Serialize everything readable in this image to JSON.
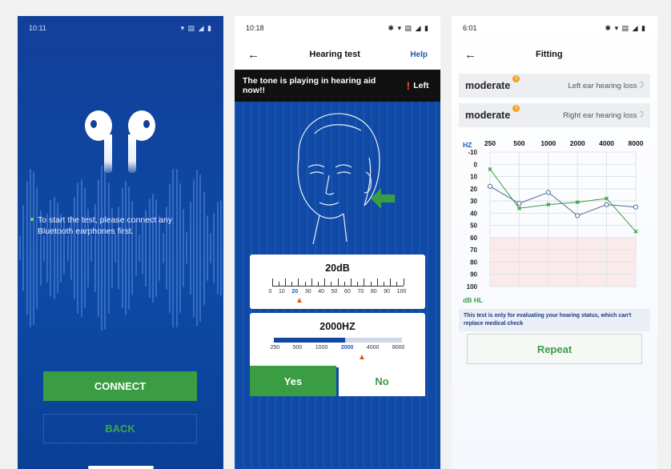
{
  "colors": {
    "brand_blue": "#123f99",
    "accent_green": "#3a9c43",
    "marker_orange": "#e8591f"
  },
  "phone1": {
    "status_time": "10:11",
    "message": "To start the test, please connect any Bluetooth earphones first.",
    "connect_label": "CONNECT",
    "back_label": "BACK"
  },
  "phone2": {
    "status_time": "10:18",
    "title": "Hearing test",
    "help_label": "Help",
    "tone_message": "The tone is playing in hearing aid now!!",
    "ear_label": "Left",
    "db_value_label": "20dB",
    "db_scale": [
      "0",
      "10",
      "20",
      "30",
      "40",
      "50",
      "60",
      "70",
      "80",
      "90",
      "100"
    ],
    "db_selected": "20",
    "hz_value_label": "2000HZ",
    "hz_scale": [
      "250",
      "500",
      "1000",
      "2000",
      "4000",
      "8000"
    ],
    "hz_selected": "2000",
    "hz_progress_fraction": 0.56,
    "yes_label": "Yes",
    "no_label": "No"
  },
  "phone3": {
    "status_time": "6:01",
    "title": "Fitting",
    "left": {
      "severity": "moderate",
      "label": "Left ear hearing loss"
    },
    "right": {
      "severity": "moderate",
      "label": "Right ear hearing loss"
    },
    "hz_label": "HZ",
    "frequencies": [
      "250",
      "500",
      "1000",
      "2000",
      "4000",
      "8000"
    ],
    "db_ticks": [
      "-10",
      "0",
      "10",
      "20",
      "30",
      "40",
      "50",
      "60",
      "70",
      "80",
      "90",
      "100"
    ],
    "unit_label": "dB HL",
    "disclaimer": "This test is only for evaluating your hearing status, which can't replace medical check",
    "repeat_label": "Repeat"
  },
  "chart_data": {
    "type": "line",
    "x": [
      "250",
      "500",
      "1000",
      "2000",
      "4000",
      "8000"
    ],
    "series": [
      {
        "name": "",
        "color": "#4f6b98",
        "marker": "circle",
        "values": [
          18,
          32,
          23,
          42,
          33,
          35
        ]
      },
      {
        "name": "",
        "color": "#3a9c43",
        "marker": "x",
        "values": [
          4,
          36,
          33,
          31,
          28,
          55
        ]
      }
    ],
    "xlabel": "HZ",
    "ylabel": "dB HL",
    "ylim": [
      -10,
      100
    ],
    "y_inverted": true,
    "grid": true
  }
}
